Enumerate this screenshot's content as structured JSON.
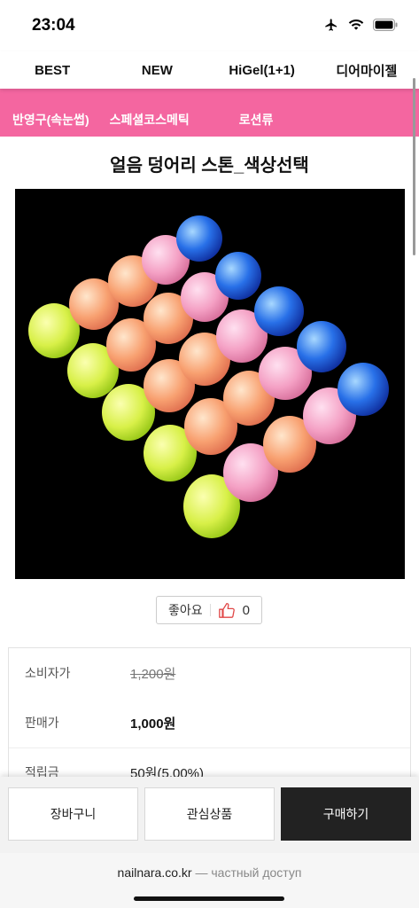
{
  "status": {
    "time": "23:04"
  },
  "nav": {
    "items": [
      "BEST",
      "NEW",
      "HiGel(1+1)",
      "디어마이젤"
    ]
  },
  "pink_menu": {
    "items": [
      "반영구(속눈썹)",
      "스페셜코스메틱",
      "로션류"
    ]
  },
  "product": {
    "title": "얼음 덩어리 스톤_색상선택"
  },
  "like": {
    "label": "좋아요",
    "count": "0"
  },
  "prices": {
    "consumer_label": "소비자가",
    "consumer_price": "1,200원",
    "sale_label": "판매가",
    "sale_price": "1,000원",
    "points_label": "적립금",
    "points_value": "50원(5.00%)"
  },
  "actions": {
    "cart": "장바구니",
    "wishlist": "관심상품",
    "buy": "구매하기"
  },
  "url": {
    "domain": "nailnara.co.kr",
    "note": " — частный доступ"
  },
  "colors": {
    "accent_pink": "#f466a0",
    "dark_button": "#222222"
  }
}
